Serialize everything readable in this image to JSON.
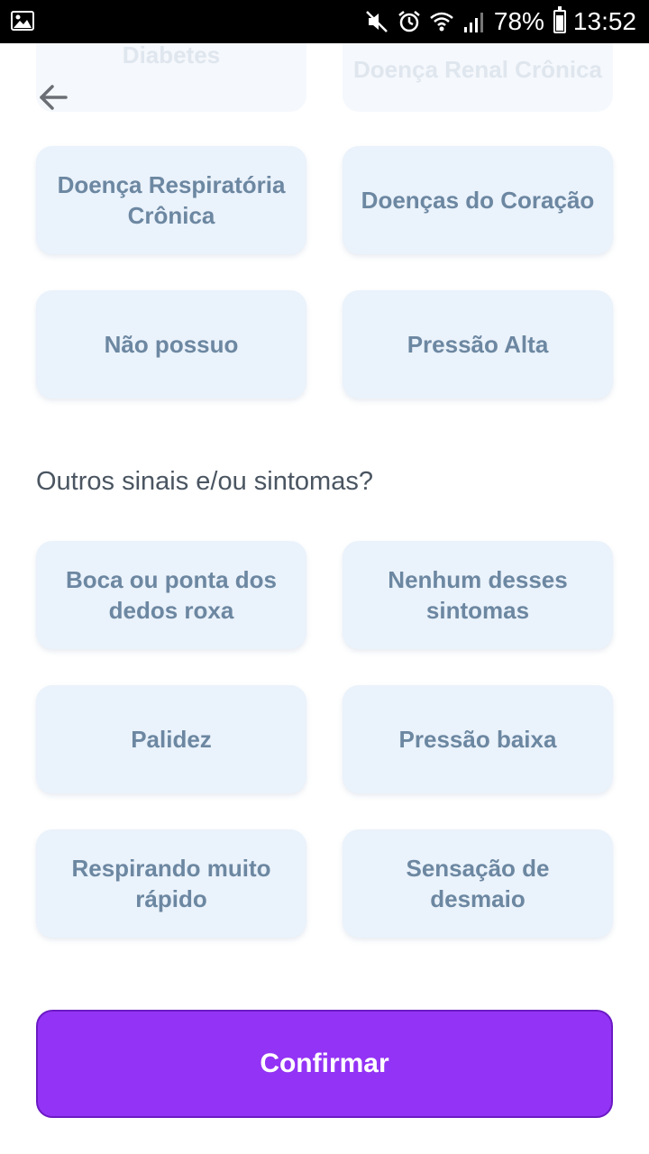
{
  "status_bar": {
    "battery": "78%",
    "time": "13:52"
  },
  "top_faded": {
    "left": "Diabetes",
    "right": "Doença Renal Crônica"
  },
  "comorbidities": [
    "Doença Respiratória Crônica",
    "Doenças do Coração",
    "Não possuo",
    "Pressão Alta"
  ],
  "symptoms_section": {
    "title": "Outros sinais e/ou sintomas?",
    "options": [
      "Boca ou ponta dos dedos roxa",
      "Nenhum desses sintomas",
      "Palidez",
      "Pressão baixa",
      "Respirando muito rápido",
      "Sensação de desmaio"
    ]
  },
  "confirm_label": "Confirmar",
  "colors": {
    "card_bg": "#eaf2fb",
    "card_text": "#6c87a1",
    "accent": "#9333f5"
  }
}
